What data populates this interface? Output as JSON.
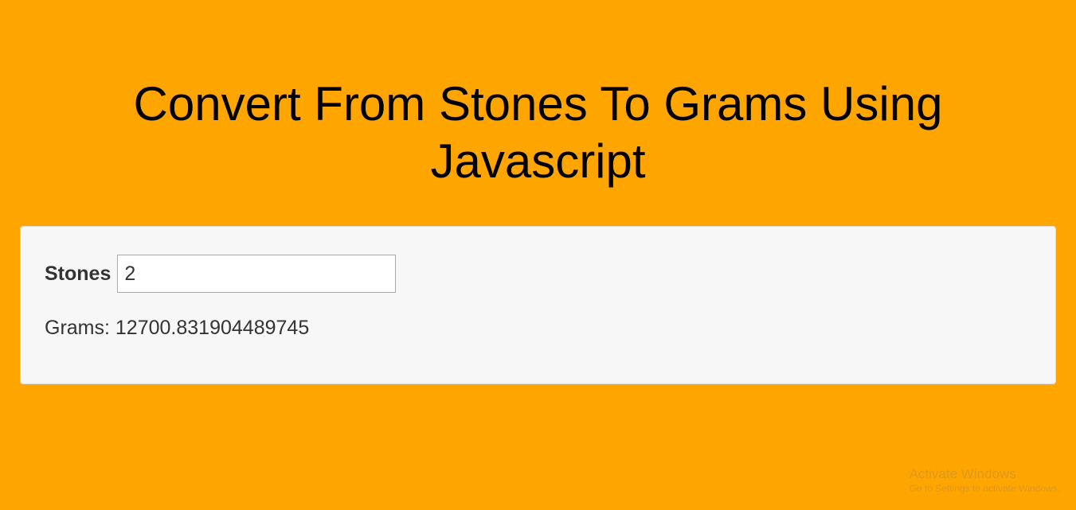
{
  "page": {
    "title": "Convert From Stones To Grams Using Javascript"
  },
  "converter": {
    "stones_label": "Stones",
    "stones_value": "2",
    "result_label": "Grams:",
    "result_value": "12700.831904489745"
  },
  "watermark": {
    "title": "Activate Windows",
    "subtitle": "Go to Settings to activate Windows."
  },
  "colors": {
    "background": "#ffa500",
    "panel_bg": "#f7f7f7",
    "panel_border": "#dddddd",
    "text_main": "#333333"
  }
}
